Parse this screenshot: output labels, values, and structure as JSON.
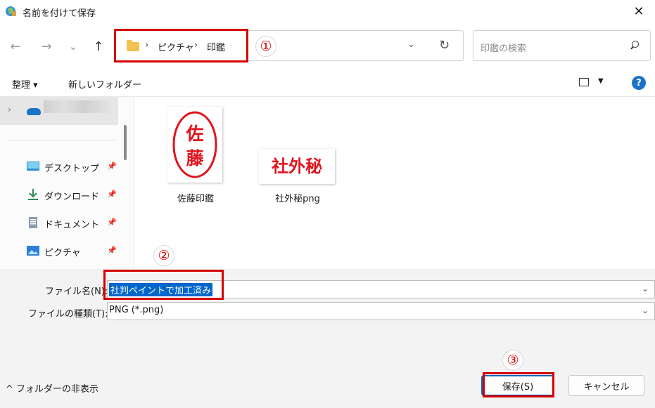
{
  "window": {
    "title": "名前を付けて保存",
    "close_glyph": "✕"
  },
  "nav": {
    "back_glyph": "←",
    "forward_glyph": "→",
    "recent_glyph": "⌄",
    "up_glyph": "↑"
  },
  "address": {
    "breadcrumb": [
      "ピクチャ",
      "印鑑"
    ],
    "separator": "›",
    "dropdown_glyph": "⌄",
    "refresh_glyph": "↻"
  },
  "search": {
    "placeholder": "印鑑の検索"
  },
  "toolbar": {
    "organize_label": "整理 ▾",
    "new_folder_label": "新しいフォルダー",
    "view_drop_glyph": "▼",
    "help_glyph": "?"
  },
  "sidebar": {
    "chevron_glyph": "›",
    "items": [
      {
        "label": "デスクトップ",
        "icon": "desktop-icon",
        "pin": "📌"
      },
      {
        "label": "ダウンロード",
        "icon": "download-icon",
        "pin": "📌"
      },
      {
        "label": "ドキュメント",
        "icon": "document-icon",
        "pin": "📌"
      },
      {
        "label": "ピクチャ",
        "icon": "pictures-icon",
        "pin": "📌"
      }
    ]
  },
  "files": [
    {
      "name": "佐藤印鑑",
      "seal_text": [
        "佐",
        "藤"
      ]
    },
    {
      "name": "社外秘png",
      "seal_text": "社外秘"
    }
  ],
  "form": {
    "filename_label": "ファイル名(N):",
    "filename_value": "社判ペイントで加工済み",
    "filetype_label": "ファイルの種類(T):",
    "filetype_value": "PNG (*.png)",
    "chevron_glyph": "⌄"
  },
  "footer": {
    "hide_folders_label": "^ フォルダーの非表示",
    "save_label": "保存(S)",
    "cancel_label": "キャンセル"
  },
  "annotations": {
    "step1": "①",
    "step2": "②",
    "step3": "③"
  },
  "colors": {
    "annotation_red": "#d40000",
    "seal_red": "#e0141e",
    "accent_blue": "#0067c0"
  }
}
